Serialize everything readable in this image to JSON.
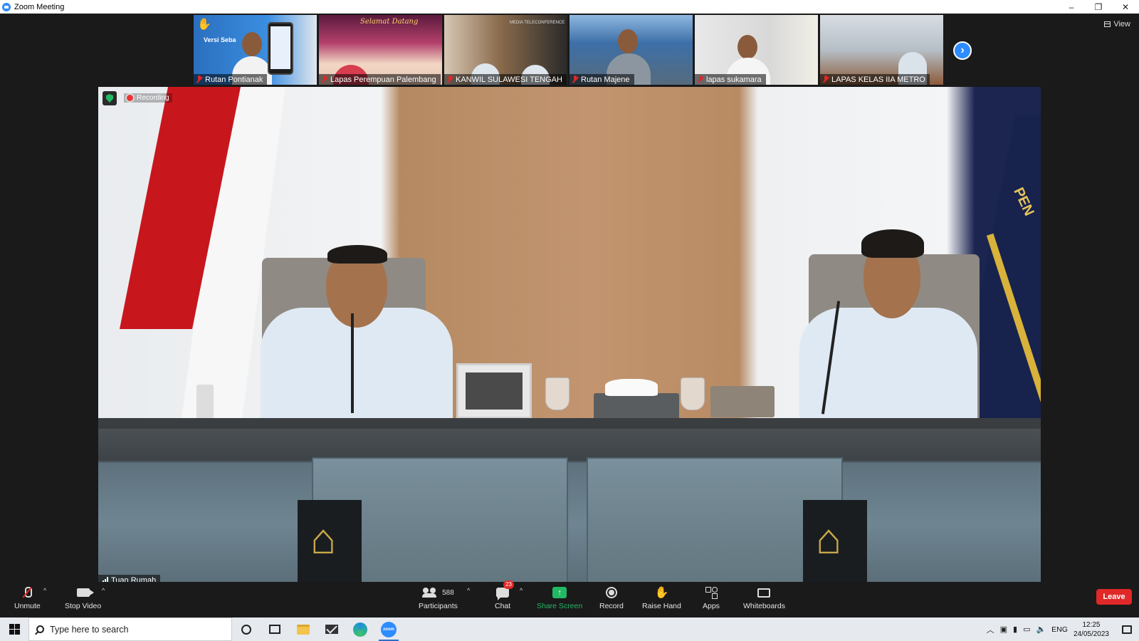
{
  "window": {
    "title": "Zoom Meeting",
    "minimize": "–",
    "restore": "❐",
    "close": "✕"
  },
  "view_button": {
    "label": "View"
  },
  "thumbnails": [
    {
      "name": "Rutan Pontianak",
      "muted": true
    },
    {
      "name": "Lapas Perempuan Palembang",
      "muted": true
    },
    {
      "name": "KANWIL SULAWESI TENGAH",
      "muted": true
    },
    {
      "name": "Rutan Majene",
      "muted": true
    },
    {
      "name": "lapas sukamara",
      "muted": true
    },
    {
      "name": "LAPAS KELAS IIA METRO",
      "muted": true
    }
  ],
  "thumb_overlay_texts": {
    "t1": "Versi Seba",
    "t2": "Selamat Datang",
    "t3": "MEDIA TELECONFERENCE"
  },
  "main_video": {
    "recording_label": "Recording",
    "speaker_name": "Tuan Rumah",
    "flag_text": "PEN"
  },
  "toolbar": {
    "unmute": "Unmute",
    "stop_video": "Stop Video",
    "participants": "Participants",
    "participants_count": "588",
    "chat": "Chat",
    "chat_badge": "23",
    "share_screen": "Share Screen",
    "record": "Record",
    "raise_hand": "Raise Hand",
    "apps": "Apps",
    "whiteboards": "Whiteboards",
    "leave": "Leave"
  },
  "taskbar": {
    "search_placeholder": "Type here to search",
    "language": "ENG",
    "time": "12:25",
    "date": "24/05/2023",
    "zoom_label": "zoom"
  },
  "colors": {
    "accent": "#2d8cff",
    "leave": "#e02828",
    "share": "#23b865",
    "muted": "#e02828"
  }
}
